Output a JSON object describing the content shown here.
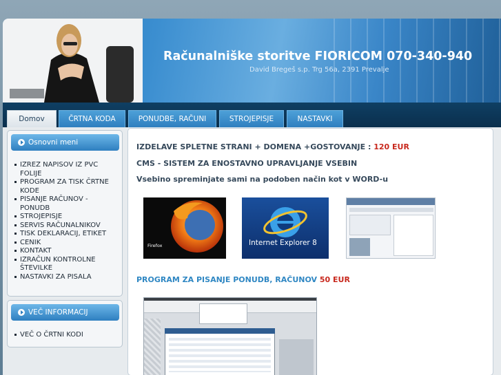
{
  "header": {
    "title": "Računalniške storitve FIORICOM 070-340-940",
    "subtitle": "David Bregeš s.p. Trg 56a, 2391 Prevalje"
  },
  "nav": {
    "tabs": [
      {
        "label": "Domov",
        "active": true
      },
      {
        "label": "ČRTNA KODA"
      },
      {
        "label": "PONUDBE, RAČUNI"
      },
      {
        "label": "STROJEPISJE"
      },
      {
        "label": "NASTAVKI"
      }
    ]
  },
  "sidebar": {
    "menu_title": "Osnovni meni",
    "items": [
      "IZREZ NAPISOV IZ PVC FOLIJE",
      "PROGRAM ZA TISK ČRTNE KODE",
      "PISANJE RAČUNOV - PONUDB",
      "STROJEPISJE",
      "SERVIS RAČUNALNIKOV",
      "TISK DEKLARACIJ, ETIKET",
      "CENIK",
      "KONTAKT",
      "IZRAČUN KONTROLNE ŠTEVILKE",
      "NASTAVKI ZA PISALA"
    ],
    "info_title": "VEČ INFORMACIJ",
    "info_items": [
      "VEČ O ČRTNI KODI"
    ]
  },
  "content": {
    "line1": "IZDELAVE SPLETNE STRANI + DOMENA +GOSTOVANJE :",
    "line1_price": "120 EUR",
    "line2": "CMS - SISTEM ZA ENOSTAVNO UPRAVLJANJE VSEBIN",
    "line3": "Vsebino spreminjate sami na podoben način kot v WORD-u",
    "firefox_logo_text": "Firefox",
    "ie_logo_text": "Internet Explorer 8",
    "program_line": "PROGRAM ZA PISANJE PONUDB, RAČUNOV",
    "program_price": "50 EUR"
  },
  "colors": {
    "accent": "#2f87c3",
    "price": "#c8281d",
    "nav_bg": "#0a2f4d"
  }
}
